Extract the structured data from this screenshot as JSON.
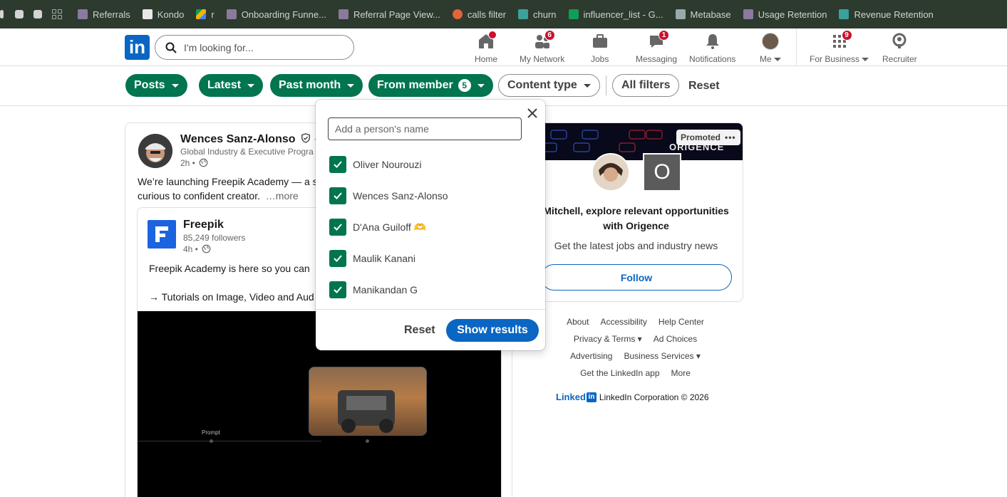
{
  "bookmarks": [
    {
      "label": "Referrals",
      "icon": "metabase-icon",
      "color": "#8a7a9e"
    },
    {
      "label": "Kondo",
      "icon": "kondo-icon",
      "color": "#e8e8e8"
    },
    {
      "label": "r",
      "icon": "drive-icon",
      "color": "#f4b400"
    },
    {
      "label": "Onboarding Funne...",
      "icon": "metabase-icon",
      "color": "#8a7a9e"
    },
    {
      "label": "Referral Page View...",
      "icon": "metabase-icon",
      "color": "#8a7a9e"
    },
    {
      "label": "calls filter",
      "icon": "app-icon",
      "color": "#e2643b"
    },
    {
      "label": "churn",
      "icon": "chart-icon",
      "color": "#3aa29a"
    },
    {
      "label": "influencer_list - G...",
      "icon": "sheets-icon",
      "color": "#0f9d58"
    },
    {
      "label": "Metabase",
      "icon": "metabase-icon",
      "color": "#9aa"
    },
    {
      "label": "Usage Retention",
      "icon": "metabase-icon",
      "color": "#8a7a9e"
    },
    {
      "label": "Revenue Retention",
      "icon": "chart-icon",
      "color": "#3aa29a"
    }
  ],
  "nav": {
    "logo": "in",
    "search_placeholder": "I'm looking for...",
    "items": [
      {
        "label": "Home",
        "badge": ""
      },
      {
        "label": "My Network",
        "badge": "6"
      },
      {
        "label": "Jobs",
        "badge": ""
      },
      {
        "label": "Messaging",
        "badge": "1"
      },
      {
        "label": "Notifications",
        "badge": ""
      },
      {
        "label": "Me",
        "badge": ""
      },
      {
        "label": "For Business",
        "badge": "9"
      },
      {
        "label": "Recruiter",
        "badge": ""
      }
    ]
  },
  "filters": {
    "pills": [
      {
        "label": "Posts",
        "active": true
      },
      {
        "label": "Latest",
        "active": true
      },
      {
        "label": "Past month",
        "active": true
      },
      {
        "label": "From member",
        "active": true,
        "count": "5"
      },
      {
        "label": "Content type",
        "active": false
      },
      {
        "label": "All filters",
        "active": false
      }
    ],
    "reset": "Reset"
  },
  "post": {
    "author": "Wences Sanz-Alonso",
    "author_suffix": "·",
    "headline": "Global Industry & Executive Progra",
    "time": "2h •",
    "text_line1": "We’re launching Freepik Academy — a s",
    "text_line2": "curious to confident creator.",
    "more": "…more",
    "shared": {
      "name": "Freepik",
      "followers": "85,249 followers",
      "time": "4h •",
      "text1": "Freepik Academy is here so you can",
      "text2": "→ Tutorials on Image, Video and Aud",
      "video_label": "Prompt"
    }
  },
  "promo": {
    "brand_text": "ORIGENCE",
    "badge": "Promoted",
    "logo_letter": "O",
    "headline": "Mitchell, explore relevant opportunities with Origence",
    "subtext": "Get the latest jobs and industry news",
    "follow": "Follow"
  },
  "footer": {
    "row1": [
      "About",
      "Accessibility",
      "Help Center"
    ],
    "row2": [
      "Privacy & Terms ▾",
      "Ad Choices"
    ],
    "row3": [
      "Advertising",
      "Business Services ▾"
    ],
    "row4": [
      "Get the LinkedIn app",
      "More"
    ],
    "brand": "Linked",
    "brand_in": "in",
    "corp": "LinkedIn Corporation © 2026"
  },
  "dropdown": {
    "placeholder": "Add a person's name",
    "options": [
      {
        "label": "Oliver Nourouzi",
        "checked": true
      },
      {
        "label": "Wences Sanz-Alonso",
        "checked": true
      },
      {
        "label": "D'Ana Guiloff 🫶",
        "checked": true
      },
      {
        "label": "Maulik Kanani",
        "checked": true
      },
      {
        "label": "Manikandan G",
        "checked": true
      }
    ],
    "reset": "Reset",
    "show_results": "Show results"
  },
  "colors": {
    "accent_green": "#01754f",
    "linkedin_blue": "#0a66c2",
    "badge_red": "#cb112d"
  }
}
